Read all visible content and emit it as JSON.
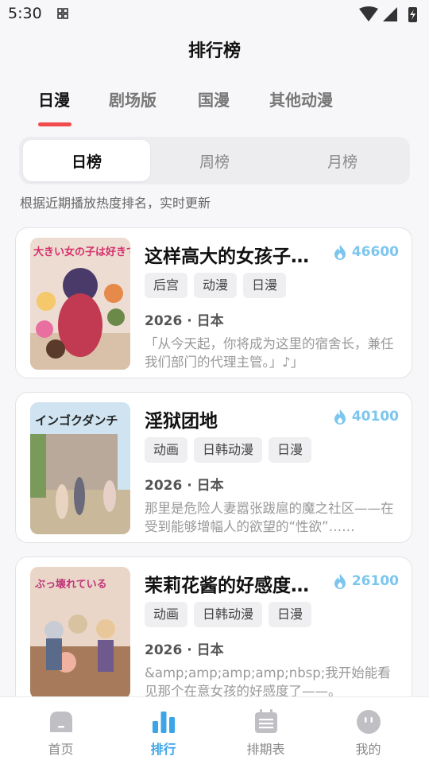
{
  "status": {
    "time": "5:30"
  },
  "page_title": "排行榜",
  "tabs": [
    {
      "label": "日漫",
      "active": true
    },
    {
      "label": "剧场版",
      "active": false
    },
    {
      "label": "国漫",
      "active": false
    },
    {
      "label": "其他动漫",
      "active": false
    }
  ],
  "periods": [
    {
      "label": "日榜",
      "active": true
    },
    {
      "label": "周榜",
      "active": false
    },
    {
      "label": "月榜",
      "active": false
    }
  ],
  "hint": "根据近期播放热度排名，实时更新",
  "items": [
    {
      "title": "这样高大的女孩子可以吗",
      "heat": "46600",
      "tags": [
        "后宫",
        "动漫",
        "日漫"
      ],
      "meta": "2026 · 日本",
      "desc": "「从今天起，你将成为这里的宿舍长，兼任我们部门的代理主管。」♪」",
      "cover_text": "大きい女の子は好きですか?",
      "cover_colors": [
        "#e7cbbf",
        "#c23a52"
      ]
    },
    {
      "title": "淫狱团地",
      "heat": "40100",
      "tags": [
        "动画",
        "日韩动漫",
        "日漫"
      ],
      "meta": "2026 · 日本",
      "desc": "那里是危险人妻嚣张跋扈的魔之社区——在受到能够增幅人的欲望的“性欲”……",
      "cover_text": "インゴクダンチ",
      "cover_colors": [
        "#cfe3f0",
        "#8a9a6a"
      ]
    },
    {
      "title": "茉莉花酱的好感度已经被毁了",
      "heat": "26100",
      "tags": [
        "动画",
        "日韩动漫",
        "日漫"
      ],
      "meta": "2026 · 日本",
      "desc": "&amp;amp;amp;amp;nbsp;我开始能看见那个在意女孩的好感度了——。",
      "cover_text": "ぶっ壊れている",
      "cover_colors": [
        "#ead6c8",
        "#6e5a8c"
      ]
    }
  ],
  "bottom_nav": [
    {
      "label": "首页",
      "icon": "home-icon",
      "active": false
    },
    {
      "label": "排行",
      "icon": "ranking-icon",
      "active": true
    },
    {
      "label": "排期表",
      "icon": "calendar-icon",
      "active": false
    },
    {
      "label": "我的",
      "icon": "profile-icon",
      "active": false
    }
  ],
  "colors": {
    "accent": "#3ba5e8",
    "heat": "#7cc6ee",
    "indicator": "#f24b4b"
  }
}
